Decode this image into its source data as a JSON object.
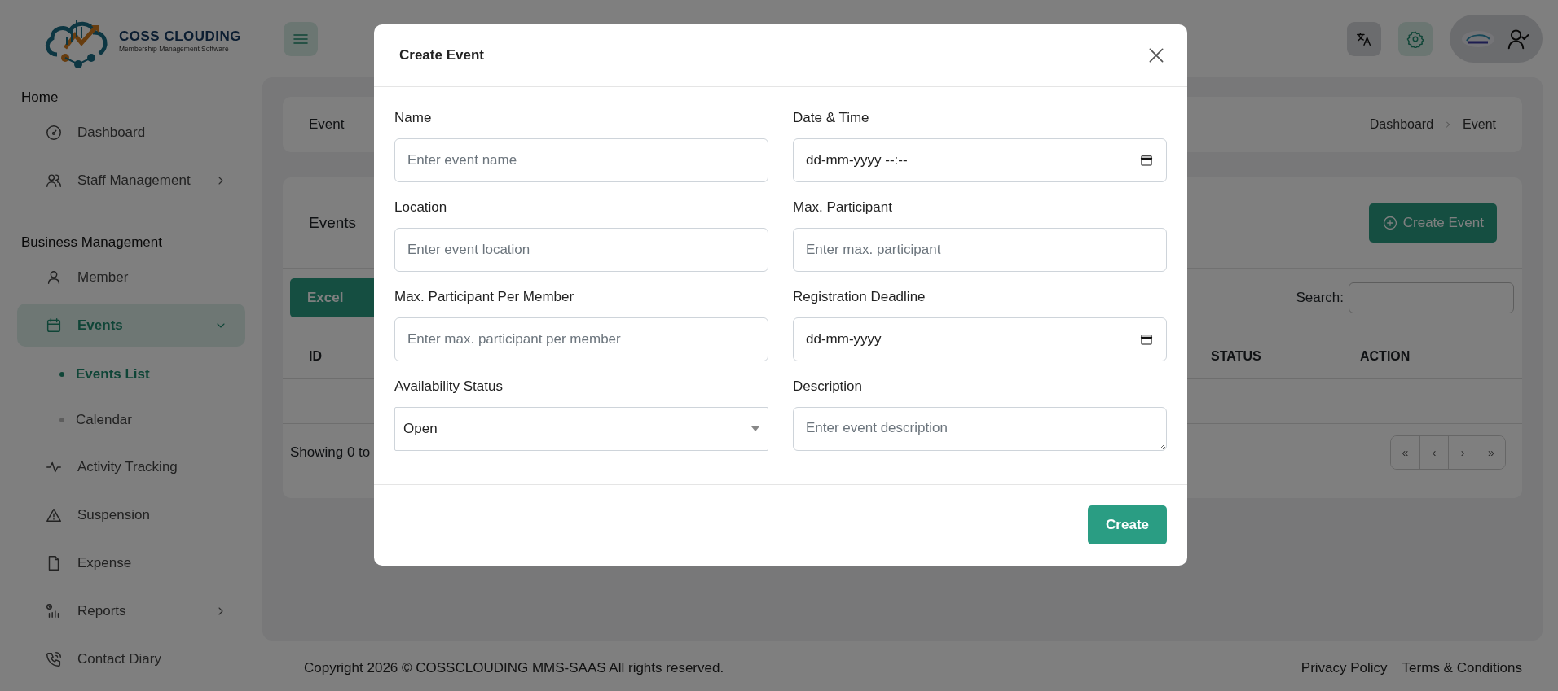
{
  "brand": {
    "name": "COSS CLOUDING",
    "tagline": "Membership Management Software"
  },
  "sidebar": {
    "sections": [
      {
        "title": "Home",
        "items": [
          {
            "label": "Dashboard",
            "selected": false
          },
          {
            "label": "Staff Management",
            "selected": false,
            "expanded": false
          }
        ]
      },
      {
        "title": "Business Management",
        "items": [
          {
            "label": "Member",
            "selected": false
          },
          {
            "label": "Events",
            "selected": true,
            "expanded": true,
            "children": [
              {
                "label": "Events List",
                "selected": true
              },
              {
                "label": "Calendar",
                "selected": false
              }
            ]
          },
          {
            "label": "Activity Tracking",
            "selected": false
          },
          {
            "label": "Suspension",
            "selected": false
          },
          {
            "label": "Expense",
            "selected": false
          },
          {
            "label": "Reports",
            "selected": false,
            "expanded": false
          },
          {
            "label": "Contact Diary",
            "selected": false
          }
        ]
      }
    ]
  },
  "page": {
    "title": "Event",
    "breadcrumb": [
      "Dashboard",
      "Event"
    ]
  },
  "events_card": {
    "title": "Events",
    "create_button": "Create Event",
    "export_button": "Excel",
    "search_label": "Search:",
    "columns": [
      "ID",
      "STATUS",
      "ACTION"
    ],
    "showing": "Showing 0 to",
    "pagination": [
      "«",
      "‹",
      "›",
      "»"
    ]
  },
  "footer": {
    "copyright": "Copyright 2026 © COSSCLOUDING MMS-SAAS All rights reserved.",
    "links": [
      "Privacy Policy",
      "Terms & Conditions"
    ]
  },
  "modal": {
    "title": "Create Event",
    "fields": [
      {
        "label": "Name",
        "kind": "text",
        "placeholder": "Enter event name"
      },
      {
        "label": "Date & Time",
        "kind": "date",
        "value": "dd-mm-yyyy --:--"
      },
      {
        "label": "Location",
        "kind": "text",
        "placeholder": "Enter event location"
      },
      {
        "label": "Max. Participant",
        "kind": "text",
        "placeholder": "Enter max. participant"
      },
      {
        "label": "Max. Participant Per Member",
        "kind": "text",
        "placeholder": "Enter max. participant per member"
      },
      {
        "label": "Registration Deadline",
        "kind": "date",
        "value": "dd-mm-yyyy"
      },
      {
        "label": "Availability Status",
        "kind": "select",
        "value": "Open"
      },
      {
        "label": "Description",
        "kind": "textarea",
        "placeholder": "Enter event description"
      }
    ],
    "submit": "Create"
  }
}
